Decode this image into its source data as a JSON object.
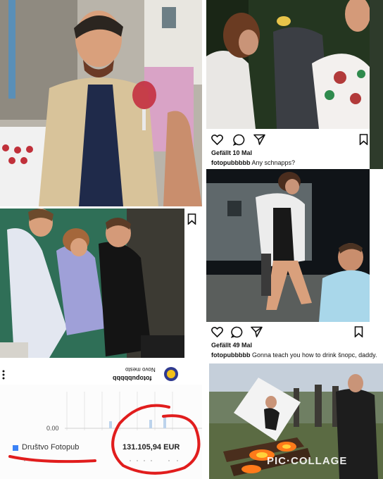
{
  "top_right_post": {
    "likes": "Gefällt 10 Mal",
    "username": "fotopubbbbb",
    "caption": "Any schnapps?"
  },
  "middle_right_post": {
    "likes": "Gefällt 49 Mal",
    "username": "fotopubbbbb",
    "caption": "Gonna teach you how to drink šnopc, daddy."
  },
  "middle_left_post": {
    "username": "fotopubbbbb",
    "location": "Novo mesto"
  },
  "finance": {
    "axis_value": "0.00",
    "account_name": "Društvo Fotopub",
    "amount": "131.105,94 EUR",
    "annotation_color": "#e11d1d",
    "account_color": "#3b82f6"
  },
  "watermark": "PIC·COLLAGE"
}
